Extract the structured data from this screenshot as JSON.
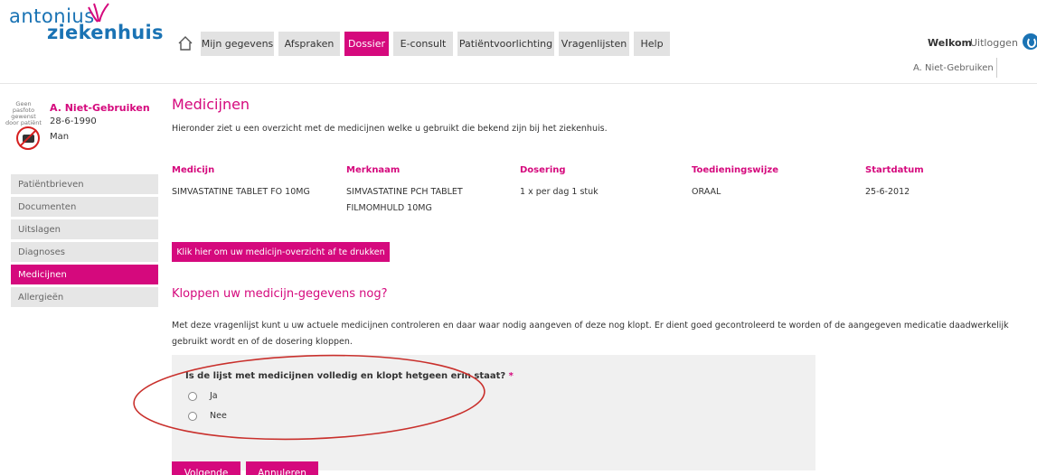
{
  "brand": {
    "line1": "antonius",
    "line2": "ziekenhuis",
    "color": "#1a73b4",
    "accent": "#d5097d"
  },
  "nav": {
    "tabs": [
      {
        "label": "Mijn gegevens",
        "active": false
      },
      {
        "label": "Afspraken",
        "active": false
      },
      {
        "label": "Dossier",
        "active": true
      },
      {
        "label": "E-consult",
        "active": false
      },
      {
        "label": "Patiëntvoorlichting",
        "active": false
      },
      {
        "label": "Vragenlijsten",
        "active": false
      },
      {
        "label": "Help",
        "active": false
      }
    ],
    "home_icon": "home-icon"
  },
  "header": {
    "welcome": "Welkom",
    "logout": "Uitloggen",
    "logout_icon": "power-icon",
    "user_name": "A. Niet-Gebruiken"
  },
  "patient": {
    "photo_text": "Geen pasfoto gewenst door patiënt",
    "photo_icon": "no-camera-icon",
    "name": "A. Niet-Gebruiken",
    "dob": "28-6-1990",
    "sex": "Man"
  },
  "sidebar": {
    "items": [
      {
        "label": "Patiëntbrieven",
        "active": false
      },
      {
        "label": "Documenten",
        "active": false
      },
      {
        "label": "Uitslagen",
        "active": false
      },
      {
        "label": "Diagnoses",
        "active": false
      },
      {
        "label": "Medicijnen",
        "active": true
      },
      {
        "label": "Allergieën",
        "active": false
      }
    ]
  },
  "main": {
    "title": "Medicijnen",
    "intro": "Hieronder ziet u een overzicht met de medicijnen welke u gebruikt die bekend zijn bij het ziekenhuis.",
    "table": {
      "headers": [
        "Medicijn",
        "Merknaam",
        "Dosering",
        "Toedieningswijze",
        "Startdatum"
      ],
      "rows": [
        [
          "SIMVASTATINE TABLET FO 10MG",
          "SIMVASTATINE PCH TABLET FILMOMHULD 10MG",
          "1 x per dag 1 stuk",
          "ORAAL",
          "25-6-2012"
        ]
      ]
    },
    "print_button": "Klik hier om uw medicijn-overzicht af te drukken",
    "section_title": "Kloppen uw medicijn-gegevens nog?",
    "section_text": "Met deze vragenlijst kunt u uw actuele medicijnen controleren en daar waar nodig aangeven of deze nog klopt. Er dient goed gecontroleerd te worden of de aangegeven medicatie daadwerkelijk gebruikt wordt en of de dosering kloppen.",
    "question": {
      "label": "Is de lijst met medicijnen volledig en klopt hetgeen erin staat?",
      "required_mark": "*",
      "options": [
        "Ja",
        "Nee"
      ],
      "selected": null
    },
    "buttons": {
      "next": "Volgende",
      "cancel": "Annuleren"
    }
  }
}
